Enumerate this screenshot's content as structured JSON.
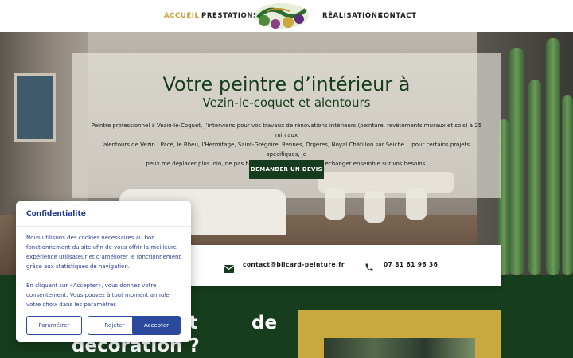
{
  "nav": {
    "items": [
      {
        "label": "ACCUEIL",
        "active": true
      },
      {
        "label": "PRESTATIONS",
        "active": false
      },
      {
        "label": "RÉALISATIONS",
        "active": false
      },
      {
        "label": "CONTACT",
        "active": false
      }
    ],
    "logo_icon": "brush-leaf-logo"
  },
  "hero": {
    "title": "Votre peintre d’intérieur à",
    "subtitle": "Vezin-le-coquet et alentours",
    "description_line1": "Peintre professionnel à Vezin-le-Coquet, j’interviens pour vos travaux de rénovations intérieurs (peinture, revêtements muraux et sols) à 25 min aux",
    "description_line2": "alentours de Vezin : Pacé, le Rheu, l’Hermitage, Saint-Grégoire, Rennes, Orgères, Noyal Châtillon sur Seiche… pour certains projets spécifiques, je",
    "description_line3": "peux me déplacer plus loin, ne pas hésiter à me contacter pour échanger ensemble sur vos besoins.",
    "cta_label": "DEMANDER UN DEVIS"
  },
  "contact": {
    "email": "contact@bilcard-peinture.fr",
    "phone": "07 81 61 96 36",
    "email_icon": "envelope-icon",
    "phone_icon": "phone-icon"
  },
  "section": {
    "heading_frag_1": "et",
    "heading_frag_2": "de",
    "heading_frag_3": "décoration ?"
  },
  "cookie": {
    "title": "Confidentialité",
    "para1": "Nous utilisons des cookies nécessaires au bon fonctionnement du site afin de vous offrir la meilleure expérience utilisateur et d’améliorer le fonctionnement grâce aux statistiques de navigation.",
    "para2": "En cliquant sur «Accepter», vous donnez votre consentement. Vous pouvez à tout moment annuler votre choix dans les paramètres",
    "btn_settings": "Paramétrer",
    "btn_reject": "Rejeter",
    "btn_accept": "Accepter"
  },
  "colors": {
    "dark_green": "#163d1c",
    "gold": "#c9a93d",
    "nav_active": "#c7a23a",
    "cookie_blue": "#2b4a9e"
  }
}
